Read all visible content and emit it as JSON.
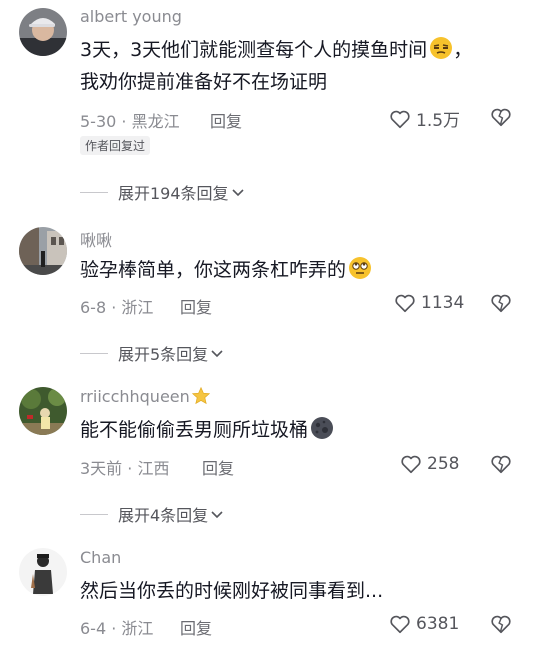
{
  "comments": [
    {
      "username": "albert young",
      "text_line1": "3天，3天他们就能测查每个人的摸鱼时间",
      "text_line2_pre": "，",
      "text_line2": "我劝你提前准备好不在场证明",
      "emoji": "sly-face-emoji",
      "time": "5-30",
      "location": "黑龙江",
      "reply_label": "回复",
      "likes": "1.5万",
      "author_tag": "作者回复过",
      "expand_label": "展开194条回复"
    },
    {
      "username": "啾啾",
      "text": "验孕棒简单，你这两条杠咋弄的",
      "emoji": "rolling-eyes-emoji",
      "time": "6-8",
      "location": "浙江",
      "reply_label": "回复",
      "likes": "1134",
      "expand_label": "展开5条回复"
    },
    {
      "username": "rriicchhqueen",
      "username_icon": "star-icon",
      "text": "能不能偷偷丢男厕所垃圾桶",
      "emoji": "dark-moon-emoji",
      "time": "3天前",
      "location": "江西",
      "reply_label": "回复",
      "likes": "258",
      "expand_label": "展开4条回复"
    },
    {
      "username": "Chan",
      "text": "然后当你丢的时候刚好被同事看到...",
      "time": "6-4",
      "location": "浙江",
      "reply_label": "回复",
      "likes": "6381"
    }
  ],
  "separator": "·",
  "colors": {
    "secondary_text": "#8a8b91",
    "primary_text": "#161823",
    "tag_bg": "#f1f1f2"
  }
}
